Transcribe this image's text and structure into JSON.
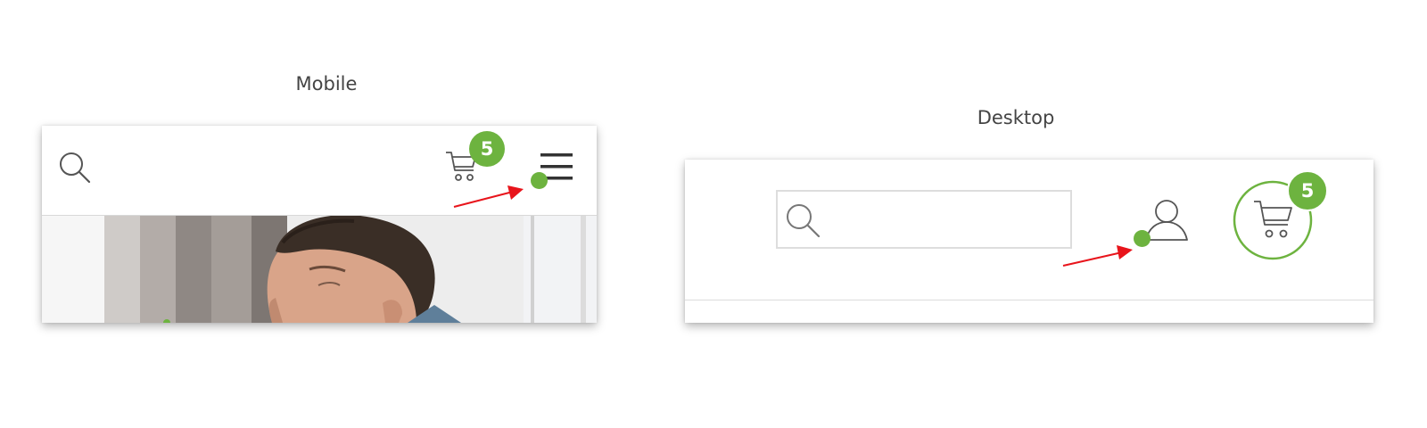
{
  "mobile": {
    "label": "Mobile",
    "header": {
      "search_icon": "search-icon",
      "cart_icon": "cart-icon",
      "cart_count": "5",
      "menu_icon": "hamburger-menu-icon"
    },
    "hero_image": "portrait-photo"
  },
  "desktop": {
    "label": "Desktop",
    "header": {
      "search_icon": "search-icon",
      "search_value": "",
      "account_icon": "user-account-icon",
      "cart_icon": "cart-icon",
      "cart_count": "5"
    }
  },
  "colors": {
    "accent_green": "#6db33f",
    "annotation_red": "#e8141b",
    "icon_gray": "#555555",
    "label_text": "#444444"
  }
}
